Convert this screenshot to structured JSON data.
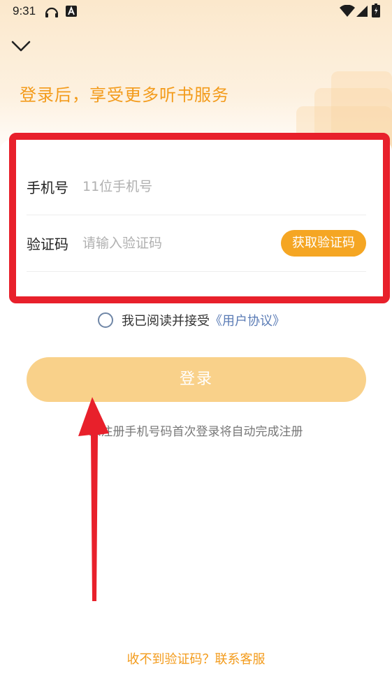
{
  "status_bar": {
    "time": "9:31"
  },
  "header": {
    "headline": "登录后，享受更多听书服务"
  },
  "form": {
    "phone_label": "手机号",
    "phone_placeholder": "11位手机号",
    "phone_value": "",
    "code_label": "验证码",
    "code_placeholder": "请输入验证码",
    "code_value": "",
    "get_code_button": "获取验证码"
  },
  "agreement": {
    "prefix": "我已阅读并接受",
    "link_text": "《用户协议》",
    "checked": false
  },
  "login_button": "登录",
  "hint": "未注册手机号码首次登录将自动完成注册",
  "help_link": "收不到验证码？联系客服",
  "colors": {
    "accent": "#f39b1b",
    "button_disabled": "#f9d18a",
    "annotation_red": "#e8202b",
    "link": "#5a7bb5"
  },
  "icons": {
    "collapse": "chevron-down-icon",
    "headphones": "headphones-icon",
    "notification": "font-a-icon",
    "wifi": "wifi-icon",
    "signal": "signal-icon",
    "battery": "battery-icon"
  }
}
